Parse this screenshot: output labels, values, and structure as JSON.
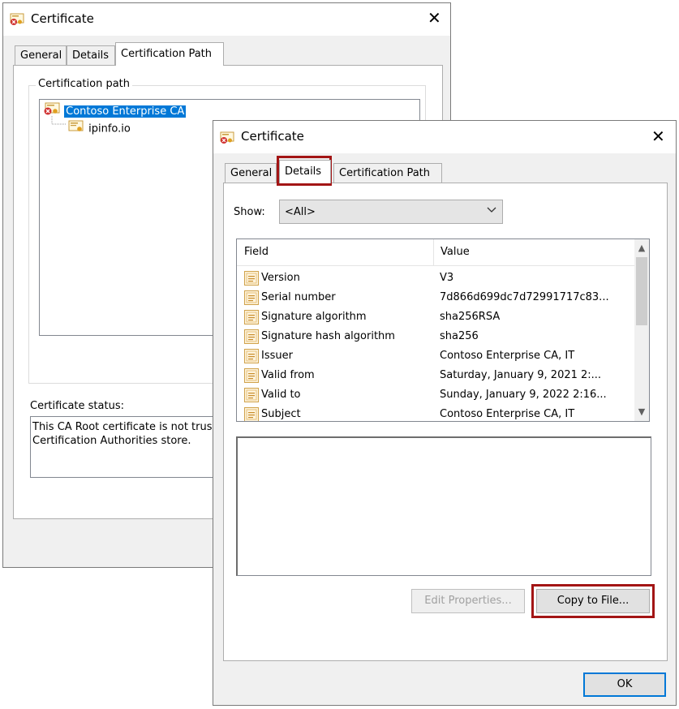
{
  "back_window": {
    "title": "Certificate",
    "tabs": [
      "General",
      "Details",
      "Certification Path"
    ],
    "active_tab": "Certification Path",
    "path_group_label": "Certification path",
    "tree": [
      {
        "label": "Contoso Enterprise CA",
        "selected": true,
        "status": "error"
      },
      {
        "label": "ipinfo.io",
        "selected": false,
        "status": "normal"
      }
    ],
    "status_label": "Certificate status:",
    "status_text_line1": "This CA Root certificate is not trus",
    "status_text_line2": "Certification Authorities store."
  },
  "front_window": {
    "title": "Certificate",
    "tabs": [
      "General",
      "Details",
      "Certification Path"
    ],
    "active_tab": "Details",
    "show_label": "Show:",
    "show_value": "<All>",
    "columns": {
      "field": "Field",
      "value": "Value"
    },
    "rows": [
      {
        "field": "Version",
        "value": "V3"
      },
      {
        "field": "Serial number",
        "value": "7d866d699dc7d72991717c83..."
      },
      {
        "field": "Signature algorithm",
        "value": "sha256RSA"
      },
      {
        "field": "Signature hash algorithm",
        "value": "sha256"
      },
      {
        "field": "Issuer",
        "value": "Contoso Enterprise CA, IT"
      },
      {
        "field": "Valid from",
        "value": "Saturday, January 9, 2021 2:..."
      },
      {
        "field": "Valid to",
        "value": "Sunday, January 9, 2022 2:16..."
      },
      {
        "field": "Subject",
        "value": "Contoso Enterprise CA, IT"
      }
    ],
    "edit_properties_label": "Edit Properties...",
    "copy_to_file_label": "Copy to File...",
    "ok_label": "OK"
  },
  "colors": {
    "highlight": "#a31515",
    "selection": "#0078d7"
  }
}
